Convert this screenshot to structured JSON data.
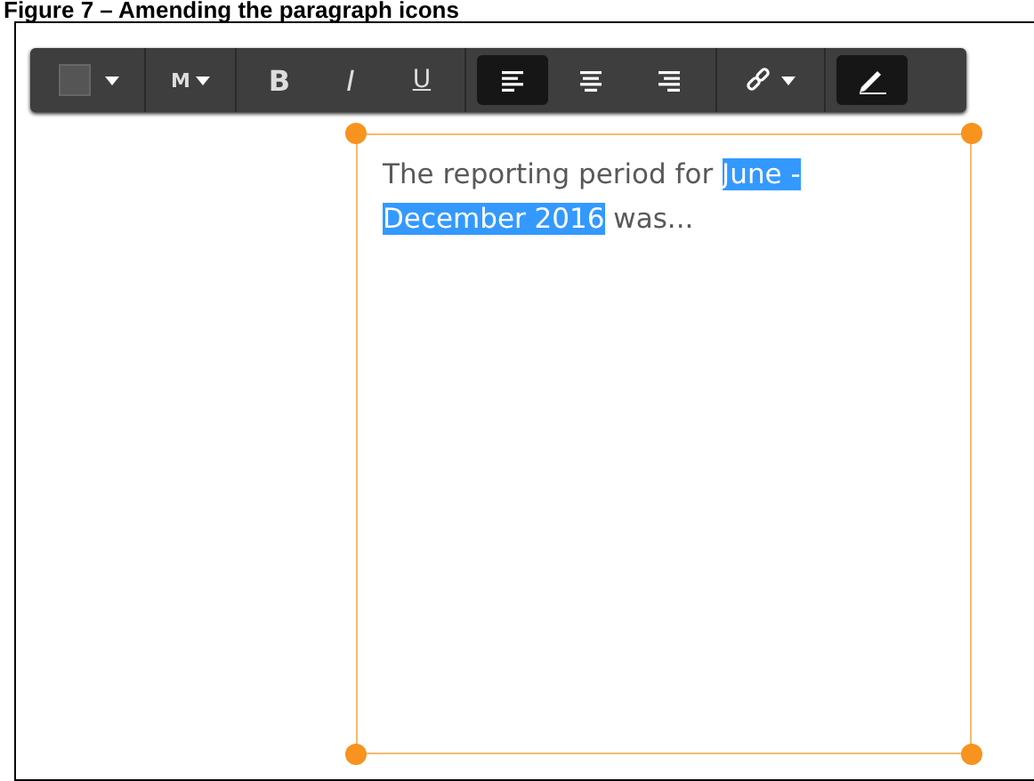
{
  "caption": "Figure 7 – Amending the paragraph icons",
  "toolbar": {
    "groups": [
      {
        "buttons": [
          {
            "kind": "color",
            "selected": false
          }
        ]
      },
      {
        "buttons": [
          {
            "kind": "size",
            "label": "M",
            "selected": false
          }
        ]
      },
      {
        "buttons": [
          {
            "kind": "bold",
            "label": "B",
            "selected": false
          },
          {
            "kind": "italic",
            "label": "I",
            "selected": false
          },
          {
            "kind": "underline",
            "label": "U",
            "selected": false
          }
        ]
      },
      {
        "buttons": [
          {
            "kind": "align-left",
            "selected": true
          },
          {
            "kind": "align-center",
            "selected": false
          },
          {
            "kind": "align-right",
            "selected": false
          }
        ]
      },
      {
        "buttons": [
          {
            "kind": "link",
            "selected": false
          }
        ]
      },
      {
        "buttons": [
          {
            "kind": "edit",
            "selected": true
          }
        ]
      }
    ]
  },
  "text_box": {
    "segments": [
      {
        "text": "The reporting period for ",
        "highlighted": false
      },
      {
        "text": "June - December 2016",
        "highlighted": true
      },
      {
        "text": " was...",
        "highlighted": false
      }
    ]
  }
}
